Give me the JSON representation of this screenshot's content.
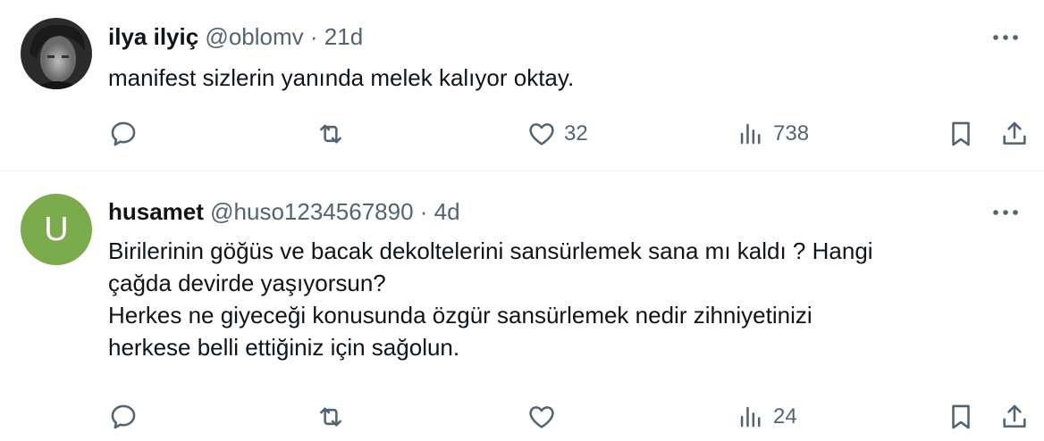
{
  "tweets": [
    {
      "name": "ilya ilyiç",
      "handle": "@oblomv",
      "dot": "·",
      "time": "21d",
      "avatar_letter": "",
      "lines": [
        "manifest sizlerin yanında melek kalıyor oktay."
      ],
      "replies": "",
      "retweets": "",
      "likes": "32",
      "views": "738"
    },
    {
      "name": "husamet",
      "handle": "@huso1234567890",
      "dot": "·",
      "time": "4d",
      "avatar_letter": "U",
      "avatar_color": "#7cab4e",
      "lines": [
        "Birilerinin göğüs ve bacak dekoltelerini sansürlemek sana mı kaldı ? Hangi",
        "çağda devirde yaşıyorsun?",
        "Herkes ne giyeceği konusunda özgür sansürlemek nedir zihniyetinizi",
        "herkese belli ettiğiniz için sağolun."
      ],
      "replies": "",
      "retweets": "",
      "likes": "",
      "views": "24"
    }
  ]
}
